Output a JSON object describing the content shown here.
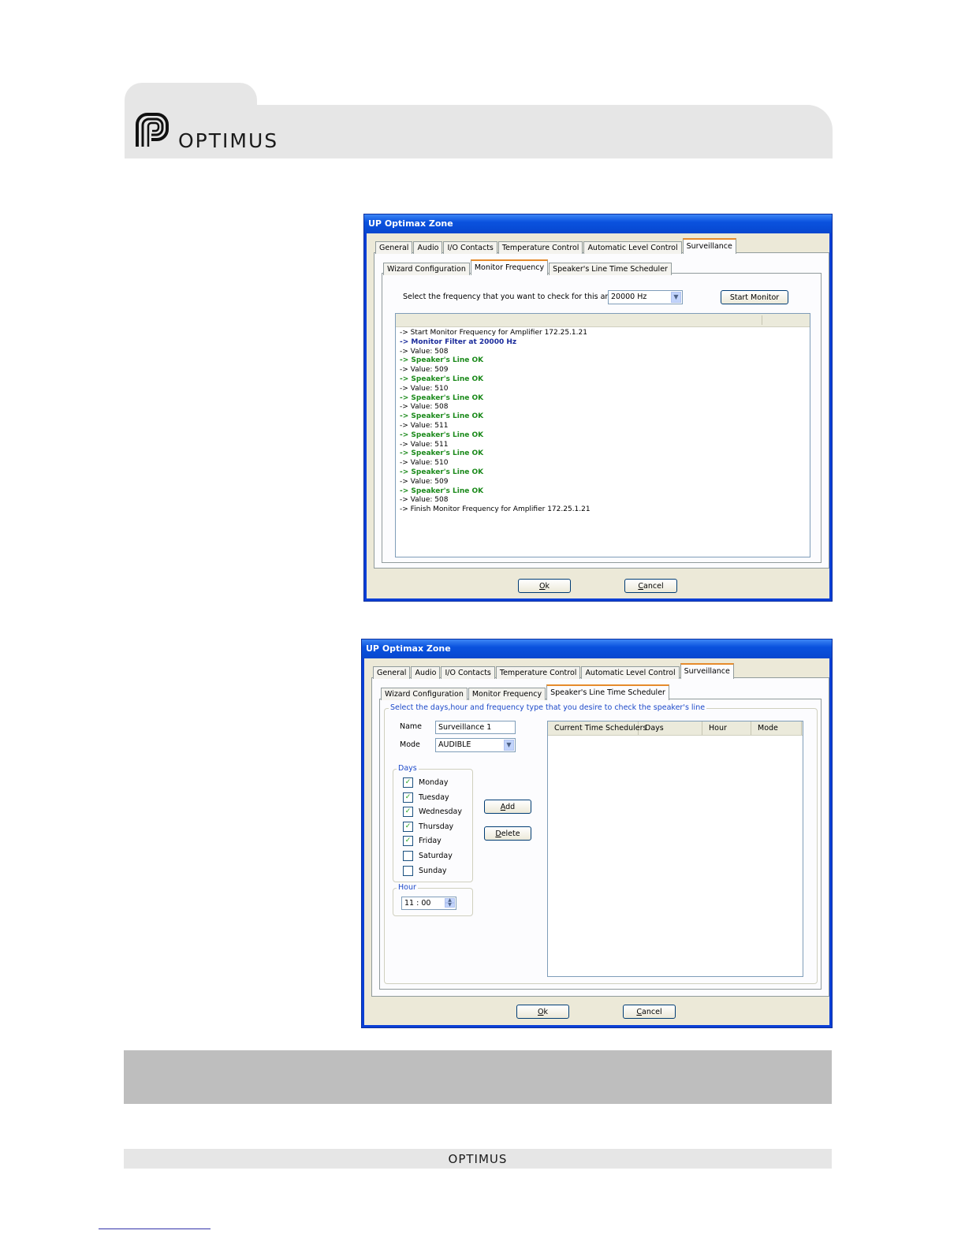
{
  "header": {
    "logo_text": "OPTIMUS"
  },
  "window1": {
    "title": "UP Optimax Zone",
    "tabs": [
      "General",
      "Audio",
      "I/O Contacts",
      "Temperature Control",
      "Automatic Level Control",
      "Surveillance"
    ],
    "active_tab": "Surveillance",
    "subtabs": [
      "Wizard Configuration",
      "Monitor Frequency",
      "Speaker's Line Time Scheduler"
    ],
    "active_subtab": "Monitor Frequency",
    "prompt": "Select the frequency that you want to check for this amplifier",
    "frequency": "20000 Hz",
    "start_button": "Start Monitor",
    "log": [
      {
        "text": "-> Start Monitor Frequency for Amplifier 172.25.1.21",
        "style": "normal"
      },
      {
        "text": "-> Monitor Filter at 20000 Hz",
        "style": "blue"
      },
      {
        "text": "-> Value: 508",
        "style": "normal"
      },
      {
        "text": "-> Speaker's Line OK",
        "style": "green"
      },
      {
        "text": "-> Value: 509",
        "style": "normal"
      },
      {
        "text": "-> Speaker's Line OK",
        "style": "green"
      },
      {
        "text": "-> Value: 510",
        "style": "normal"
      },
      {
        "text": "-> Speaker's Line OK",
        "style": "green"
      },
      {
        "text": "-> Value: 508",
        "style": "normal"
      },
      {
        "text": "-> Speaker's Line OK",
        "style": "green"
      },
      {
        "text": "-> Value: 511",
        "style": "normal"
      },
      {
        "text": "-> Speaker's Line OK",
        "style": "green"
      },
      {
        "text": "-> Value: 511",
        "style": "normal"
      },
      {
        "text": "-> Speaker's Line OK",
        "style": "green"
      },
      {
        "text": "-> Value: 510",
        "style": "normal"
      },
      {
        "text": "-> Speaker's Line OK",
        "style": "green"
      },
      {
        "text": "-> Value: 509",
        "style": "normal"
      },
      {
        "text": "-> Speaker's Line OK",
        "style": "green"
      },
      {
        "text": "-> Value: 508",
        "style": "normal"
      },
      {
        "text": "-> Finish Monitor Frequency for Amplifier 172.25.1.21",
        "style": "normal"
      }
    ],
    "ok_button": "Ok",
    "cancel_button": "Cancel"
  },
  "window2": {
    "title": "UP Optimax Zone",
    "tabs": [
      "General",
      "Audio",
      "I/O Contacts",
      "Temperature Control",
      "Automatic Level Control",
      "Surveillance"
    ],
    "active_tab": "Surveillance",
    "subtabs": [
      "Wizard Configuration",
      "Monitor Frequency",
      "Speaker's Line Time Scheduler"
    ],
    "active_subtab": "Speaker's Line Time Scheduler",
    "group_title": "Select the days,hour and frequency type that you desire to check the speaker's line",
    "name_label": "Name",
    "name_value": "Surveillance 1",
    "mode_label": "Mode",
    "mode_value": "AUDIBLE",
    "days_label": "Days",
    "days": [
      {
        "label": "Monday",
        "checked": true
      },
      {
        "label": "Tuesday",
        "checked": true
      },
      {
        "label": "Wednesday",
        "checked": true
      },
      {
        "label": "Thursday",
        "checked": true
      },
      {
        "label": "Friday",
        "checked": true
      },
      {
        "label": "Saturday",
        "checked": false
      },
      {
        "label": "Sunday",
        "checked": false
      }
    ],
    "hour_label": "Hour",
    "hour_value": "11 : 00",
    "add_button": "Add",
    "delete_button": "Delete",
    "list_columns": [
      "Current Time Schedulers",
      "Days",
      "Hour",
      "Mode"
    ],
    "ok_button": "Ok",
    "cancel_button": "Cancel"
  },
  "footer": {
    "logo_text": "OPTIMUS"
  }
}
